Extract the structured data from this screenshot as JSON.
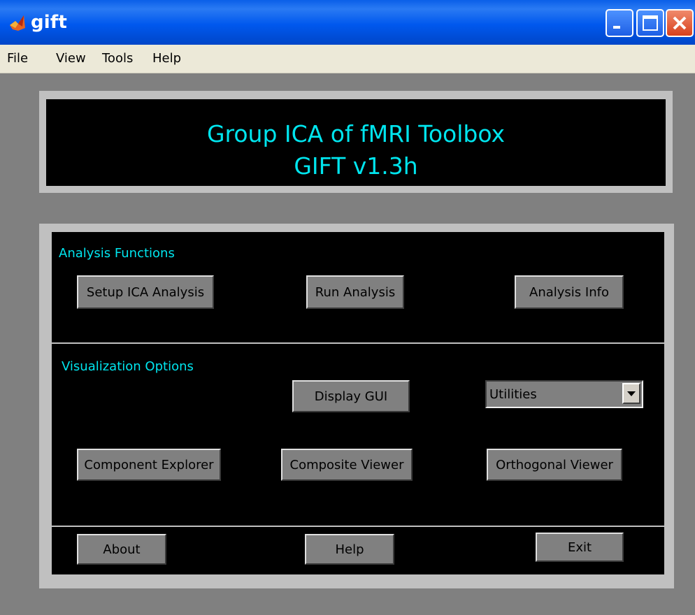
{
  "window": {
    "title": "gift"
  },
  "menubar": {
    "items": [
      {
        "label": "File"
      },
      {
        "label": "View"
      },
      {
        "label": "Tools"
      },
      {
        "label": "Help"
      }
    ]
  },
  "banner": {
    "line1": "Group ICA of fMRI Toolbox",
    "line2": "GIFT v1.3h"
  },
  "analysis": {
    "label": "Analysis Functions",
    "buttons": {
      "setup": "Setup ICA Analysis",
      "run": "Run Analysis",
      "info": "Analysis Info"
    }
  },
  "visualization": {
    "label": "Visualization Options",
    "display_gui": "Display GUI",
    "utilities_selected": "Utilities",
    "buttons": {
      "component_explorer": "Component Explorer",
      "composite_viewer": "Composite Viewer",
      "orthogonal_viewer": "Orthogonal Viewer"
    }
  },
  "bottom": {
    "about": "About",
    "help": "Help",
    "exit": "Exit"
  },
  "colors": {
    "accent_text": "#00e5ee",
    "panel_bg": "#000000",
    "window_bg": "#808080",
    "titlebar": "#0058ee"
  }
}
